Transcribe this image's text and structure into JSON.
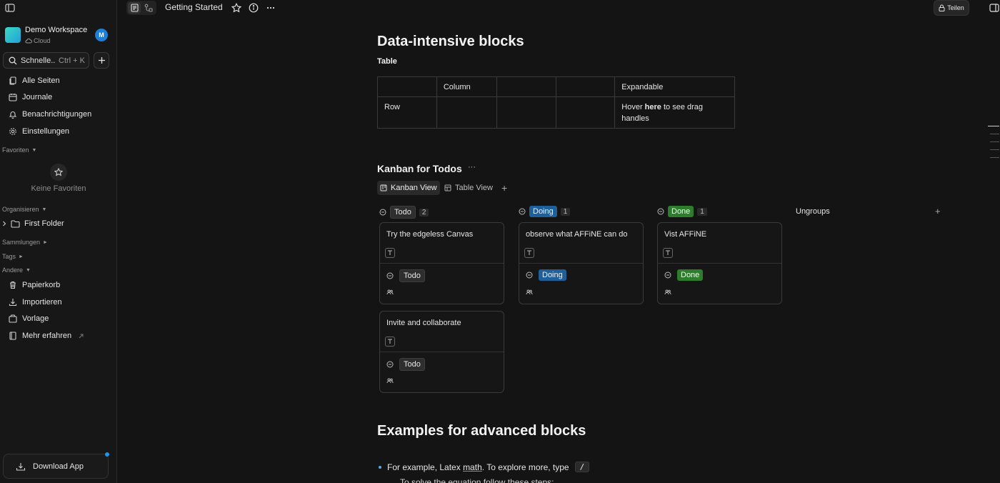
{
  "sidebar": {
    "workspace": {
      "name": "Demo Workspace",
      "sub": "Cloud",
      "avatar": "M"
    },
    "search": {
      "label": "Schnelle...",
      "shortcut": "Ctrl + K"
    },
    "nav": [
      {
        "label": "Alle Seiten",
        "icon": "pages-icon"
      },
      {
        "label": "Journale",
        "icon": "calendar-icon"
      },
      {
        "label": "Benachrichtigungen",
        "icon": "bell-icon"
      },
      {
        "label": "Einstellungen",
        "icon": "gear-icon"
      }
    ],
    "favorites": {
      "label": "Favoriten",
      "empty": "Keine Favoriten"
    },
    "organize": {
      "label": "Organisieren",
      "folder": "First Folder"
    },
    "collections": "Sammlungen",
    "tags": "Tags",
    "others": {
      "label": "Andere",
      "items": [
        {
          "label": "Papierkorb",
          "icon": "trash-icon"
        },
        {
          "label": "Importieren",
          "icon": "import-icon"
        },
        {
          "label": "Vorlage",
          "icon": "template-icon"
        },
        {
          "label": "Mehr erfahren",
          "icon": "book-icon"
        }
      ]
    },
    "download": "Download App"
  },
  "header": {
    "title": "Getting Started",
    "share": "Teilen"
  },
  "content": {
    "h_data": "Data-intensive blocks",
    "h_table": "Table",
    "table": {
      "row1": [
        "",
        "Column",
        "",
        "",
        "Expandable"
      ],
      "row2_first": "Row",
      "hover_pre": "Hover ",
      "hover_bold": "here",
      "hover_post": " to see drag handles"
    },
    "h_kanban": "Kanban for Todos",
    "more": "···",
    "views": {
      "kanban": "Kanban View",
      "table": "Table View"
    },
    "columns": [
      {
        "label": "Todo",
        "count": "2"
      },
      {
        "label": "Doing",
        "count": "1"
      },
      {
        "label": "Done",
        "count": "1"
      }
    ],
    "ungroups": "Ungroups",
    "cards": [
      {
        "title": "Try the edgeless Canvas",
        "status": "Todo"
      },
      {
        "title": "observe what AFFiNE can do",
        "status": "Doing"
      },
      {
        "title": "Vist AFFiNE",
        "status": "Done"
      },
      {
        "title": "Invite and collaborate",
        "status": "Todo"
      }
    ],
    "h_advanced": "Examples for advanced blocks",
    "bullet": {
      "pre": "For example, Latex ",
      "math": "math",
      "post": ". To explore more, type",
      "kbd": "/"
    },
    "cut_line": "To solve the equation          follow these steps:"
  },
  "colors": {
    "doing": "#1f5f9a",
    "done": "#2d7d2d",
    "accent": "#1e96eb"
  }
}
